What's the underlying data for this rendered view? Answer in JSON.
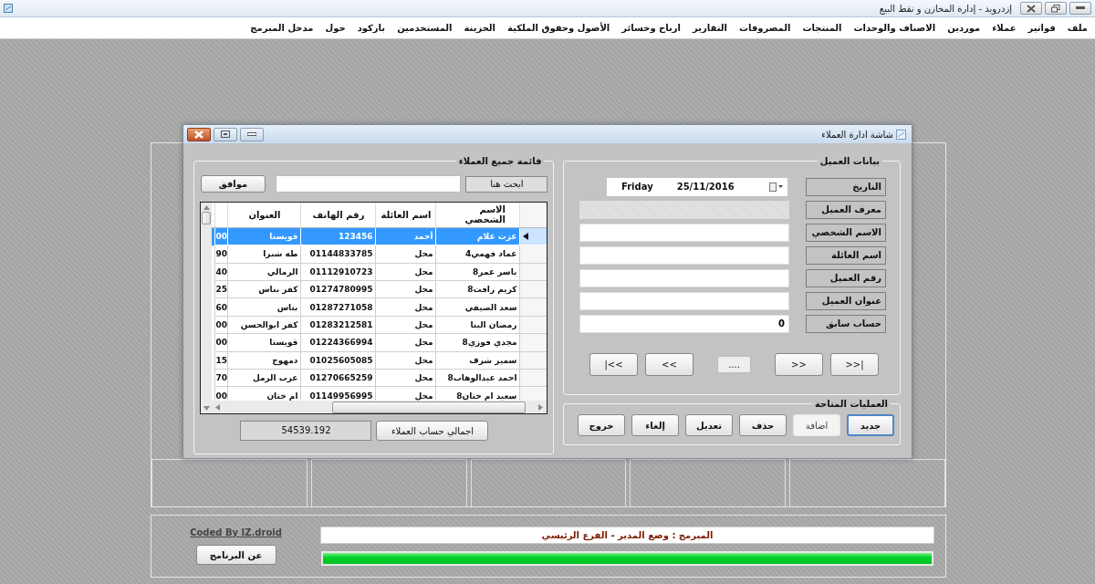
{
  "window": {
    "title": "إزدرويد - إدارة المخازن و نقط البيع"
  },
  "menu": [
    "ملف",
    "فواتير",
    "عملاء",
    "موردين",
    "الاصناف والوحدات",
    "المنتجات",
    "المصروفات",
    "التقارير",
    "ارباح وخسائر",
    "الأصول وحقوق الملكية",
    "الخزينة",
    "المستخدمين",
    "باركود",
    "حول",
    "مدخل المبرمج"
  ],
  "dialog": {
    "title": "شاشة ادارة العملاء",
    "customer_list": {
      "title": "قائمة جميع العملاء",
      "search_label": "ابحث هنا",
      "ok_button": "موافق",
      "table": {
        "columns": [
          "الاسم الشخصي",
          "اسم العائلة",
          "رقم الهاتف",
          "العنوان"
        ],
        "rows": [
          {
            "selected": true,
            "cells": [
              "عزت علام",
              "أحمد",
              "123456",
              "قويسنا"
            ],
            "column_5": "00"
          },
          {
            "selected": false,
            "cells": [
              "عماد فهمي4",
              "محل",
              "01144833785",
              "طه شبرا"
            ],
            "column_5": "90"
          },
          {
            "selected": false,
            "cells": [
              "ياسر عمر8",
              "محل",
              "01112910723",
              "الرمالي"
            ],
            "column_5": "40"
          },
          {
            "selected": false,
            "cells": [
              "كريم رافت8",
              "محل",
              "01274780995",
              "كفر بناس"
            ],
            "column_5": "25"
          },
          {
            "selected": false,
            "cells": [
              "سعد الصيفي",
              "محل",
              "01287271058",
              "بناس"
            ],
            "column_5": "60"
          },
          {
            "selected": false,
            "cells": [
              "رمضان البنا",
              "محل",
              "01283212581",
              "كفر ابوالحسن"
            ],
            "column_5": "00"
          },
          {
            "selected": false,
            "cells": [
              "مجدي فوزي8",
              "محل",
              "01224366994",
              "قويسنا"
            ],
            "column_5": "00"
          },
          {
            "selected": false,
            "cells": [
              "سمير شرف",
              "محل",
              "01025605085",
              "دمهوج"
            ],
            "column_5": "15"
          },
          {
            "selected": false,
            "cells": [
              "احمد عبدالوهاب8",
              "محل",
              "01270665259",
              "عرب الرمل"
            ],
            "column_5": "70"
          },
          {
            "selected": false,
            "cells": [
              "سعيد ام خنان8",
              "محل",
              "01149956995",
              "ام خنان"
            ],
            "column_5": "00"
          }
        ]
      },
      "total_button": "اجمالي حساب العملاء",
      "total_value": "54539.192"
    },
    "customer_data": {
      "title": "بيانات العميل",
      "date": {
        "label": "التاريخ",
        "day": "Friday",
        "value": "25/11/2016"
      },
      "fields": [
        {
          "label": "معرف العميل",
          "disabled": true
        },
        {
          "label": "الاسم الشخصي",
          "disabled": false
        },
        {
          "label": "اسم العائلة",
          "disabled": false
        },
        {
          "label": "رقم العميل",
          "disabled": false
        },
        {
          "label": "عنوان العميل",
          "disabled": false
        },
        {
          "label": "حساب سابق",
          "value": "0",
          "disabled": false
        }
      ],
      "navigation": [
        ">>|",
        ">>",
        "....",
        "<<",
        "|<<"
      ]
    },
    "operations": {
      "title": "العمليات المتاحة",
      "buttons": [
        {
          "label": "جديد",
          "focused": true,
          "disabled": false
        },
        {
          "label": "اضافة",
          "focused": false,
          "disabled": true
        },
        {
          "label": "حذف",
          "focused": false,
          "disabled": false
        },
        {
          "label": "تعديل",
          "focused": false,
          "disabled": false
        },
        {
          "label": "إلغاء",
          "focused": false,
          "disabled": false
        },
        {
          "label": "خروج",
          "focused": false,
          "disabled": false
        }
      ]
    }
  },
  "status": {
    "credit": "Coded By IZ.droid",
    "about_button": "عن البرنامج",
    "message": "المبرمج : وضع المدير - الفرع الرئيسي",
    "progress": {
      "level": 1
    }
  }
}
